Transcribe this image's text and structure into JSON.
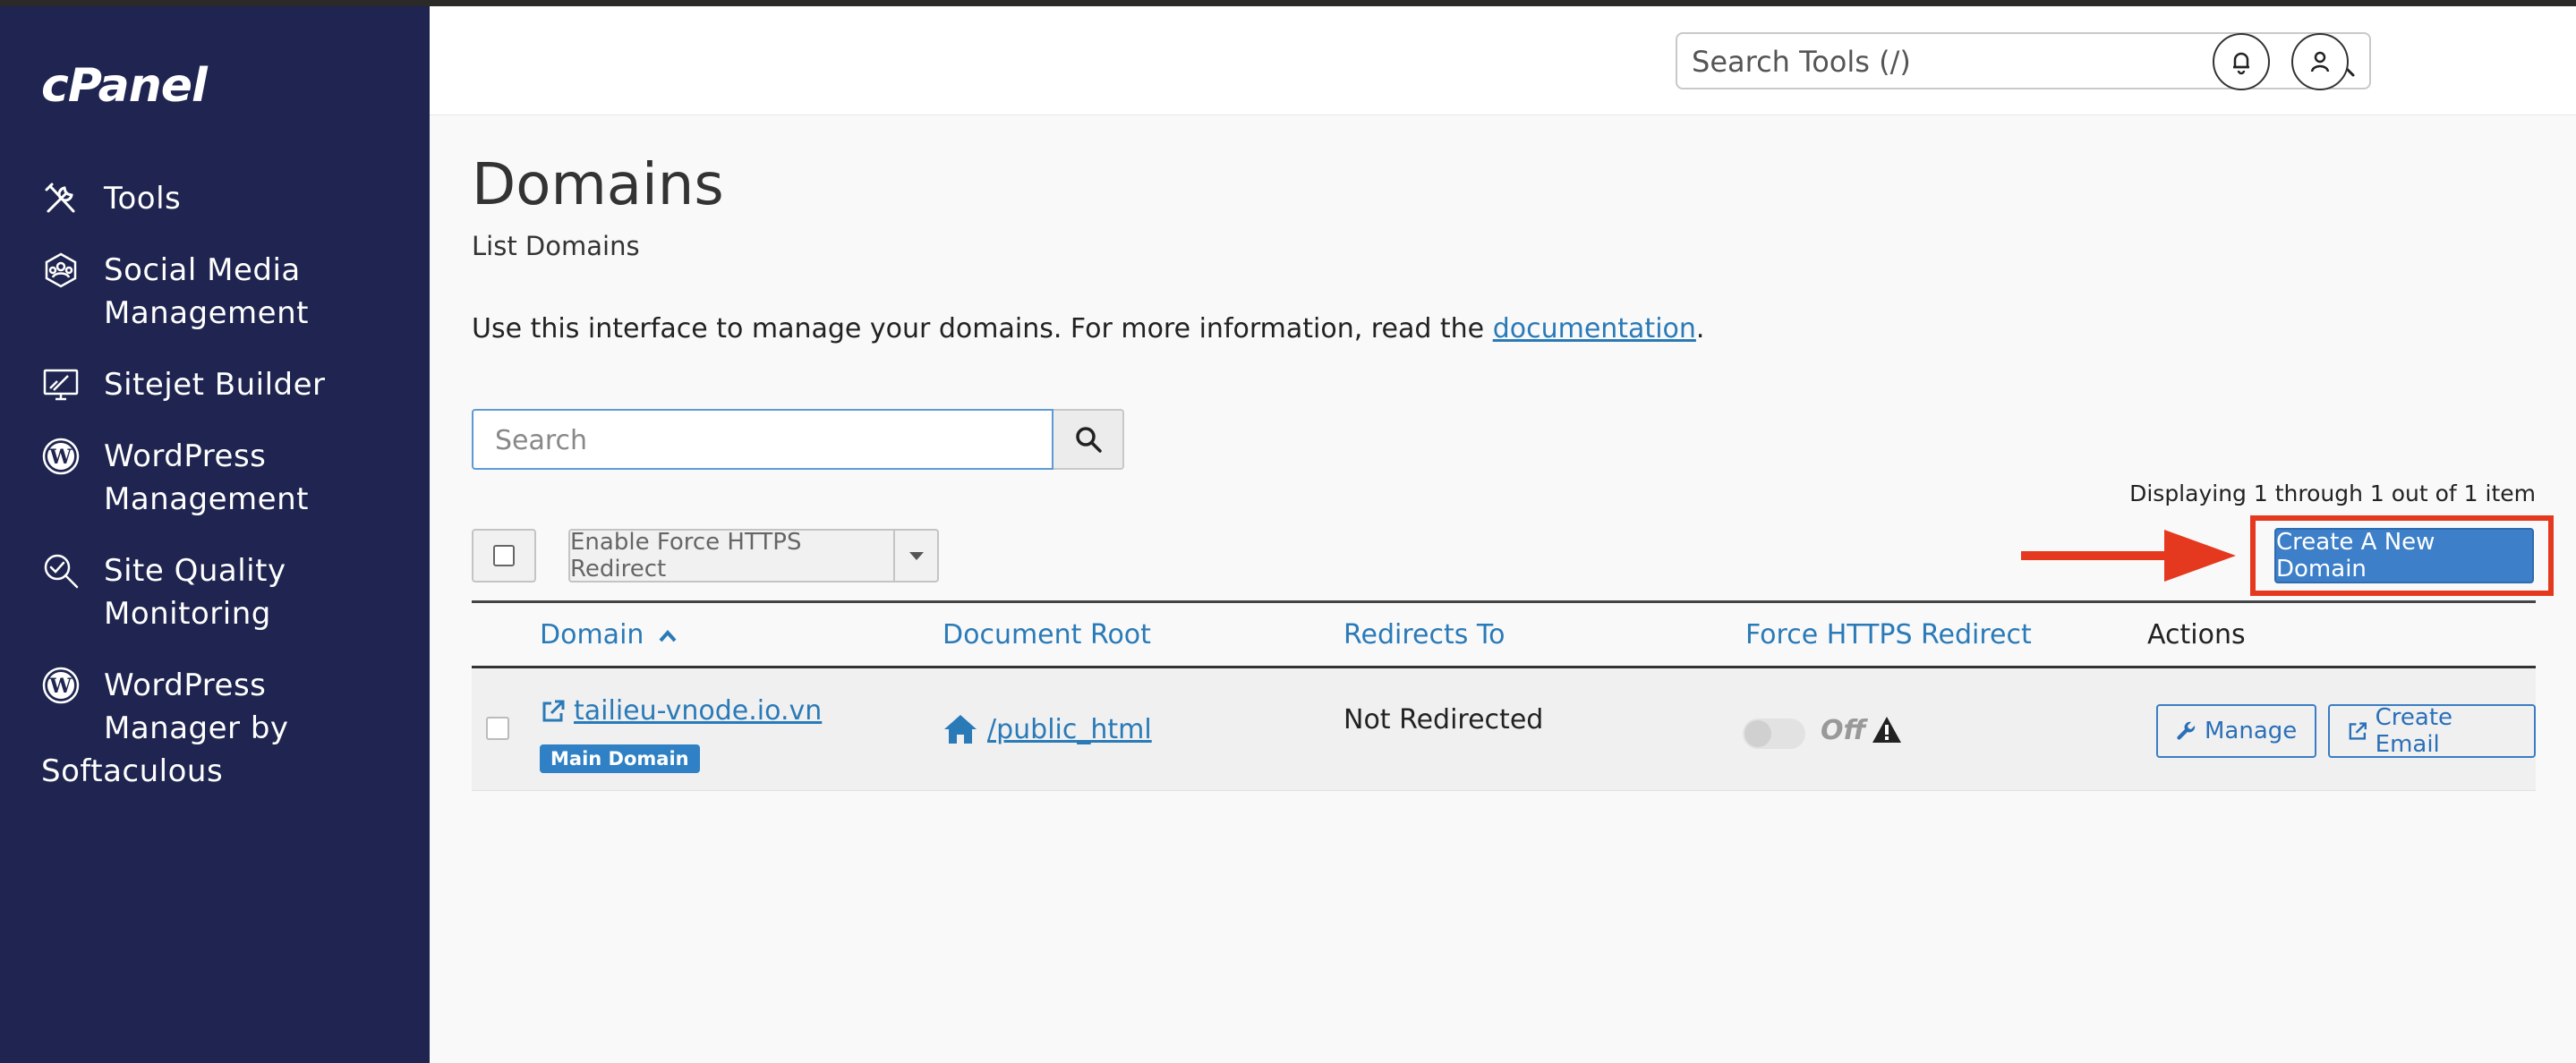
{
  "sidebar": {
    "logo": "cPanel",
    "items": [
      {
        "label": "Tools",
        "icon": "tools-icon"
      },
      {
        "label": "Social Media Management",
        "icon": "social-media-icon"
      },
      {
        "label": "Sitejet Builder",
        "icon": "sitejet-icon"
      },
      {
        "label": "WordPress Management",
        "icon": "wordpress-icon"
      },
      {
        "label": "Site Quality Monitoring",
        "icon": "site-quality-icon"
      },
      {
        "label": "WordPress Manager by Softaculous",
        "icon": "wordpress-icon"
      }
    ],
    "item_lines": [
      [
        "Tools"
      ],
      [
        "Social Media",
        "Management"
      ],
      [
        "Sitejet Builder"
      ],
      [
        "WordPress",
        "Management"
      ],
      [
        "Site Quality",
        "Monitoring"
      ],
      [
        "WordPress",
        "Manager by",
        "Softaculous"
      ]
    ]
  },
  "header": {
    "search_placeholder": "Search Tools (/)"
  },
  "main": {
    "title": "Domains",
    "subtitle": "List Domains",
    "intro_text": "Use this interface to manage your domains. For more information, read the ",
    "intro_link": "documentation",
    "intro_end": ".",
    "search_placeholder": "Search",
    "displaying": "Displaying 1 through 1 out of 1 item",
    "force_https_button": "Enable Force HTTPS Redirect",
    "create_button": "Create A New Domain",
    "columns": {
      "domain": "Domain",
      "document_root": "Document Root",
      "redirects_to": "Redirects To",
      "force_https": "Force HTTPS Redirect",
      "actions": "Actions"
    },
    "rows": [
      {
        "domain": "tailieu-vnode.io.vn",
        "badge": "Main Domain",
        "document_root": "/public_html",
        "redirects_to": "Not Redirected",
        "force_https_state": "Off",
        "manage_label": "Manage",
        "create_email_label": "Create Email"
      }
    ]
  },
  "colors": {
    "sidebar_bg": "#1f2550",
    "link": "#2a7ab8",
    "primary_button": "#3d80c9",
    "highlight": "#e5391f",
    "badge": "#2f80c4"
  }
}
